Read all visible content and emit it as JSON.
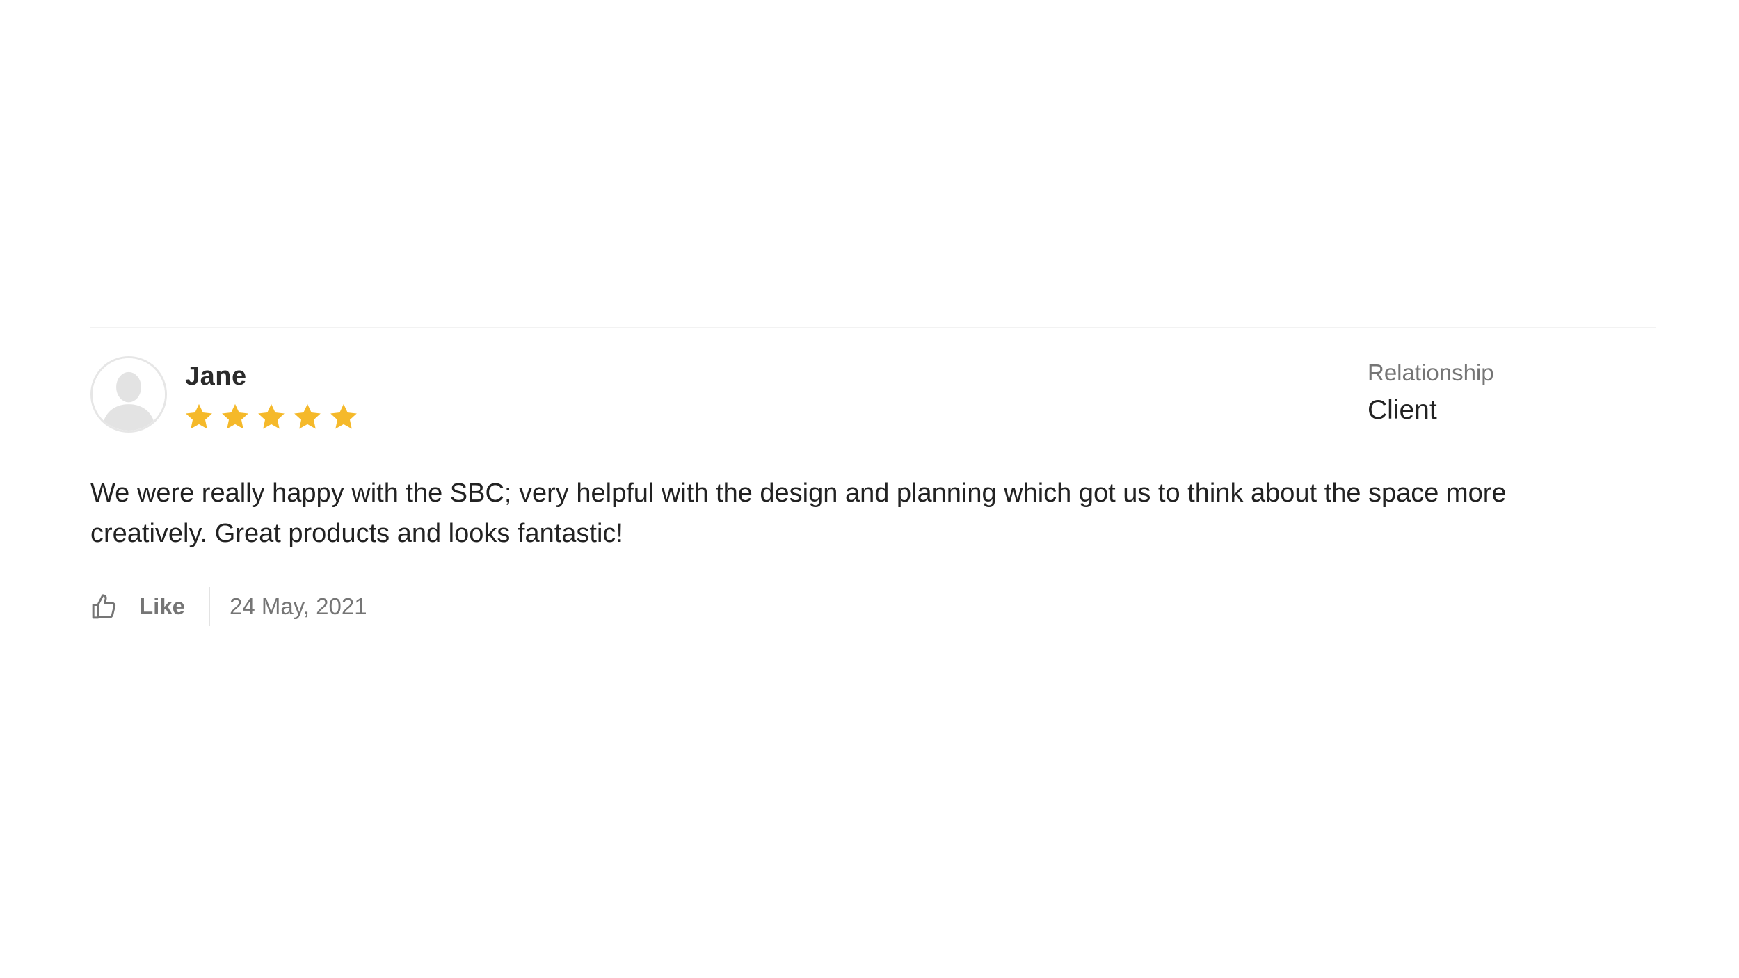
{
  "review": {
    "reviewer_name": "Jane",
    "rating": 5,
    "rating_max": 5,
    "relationship_label": "Relationship",
    "relationship_value": "Client",
    "text": "We were really happy with the SBC; very helpful with the design and planning which got us to think about the space more creatively. Great products and looks fantastic!",
    "like_label": "Like",
    "date": "24 May, 2021"
  },
  "icons": {
    "avatar": "user-silhouette-icon",
    "star": "star-icon",
    "like": "thumbs-up-icon"
  },
  "colors": {
    "star": "#F5B92A",
    "muted_text": "#757575",
    "text": "#222222"
  }
}
